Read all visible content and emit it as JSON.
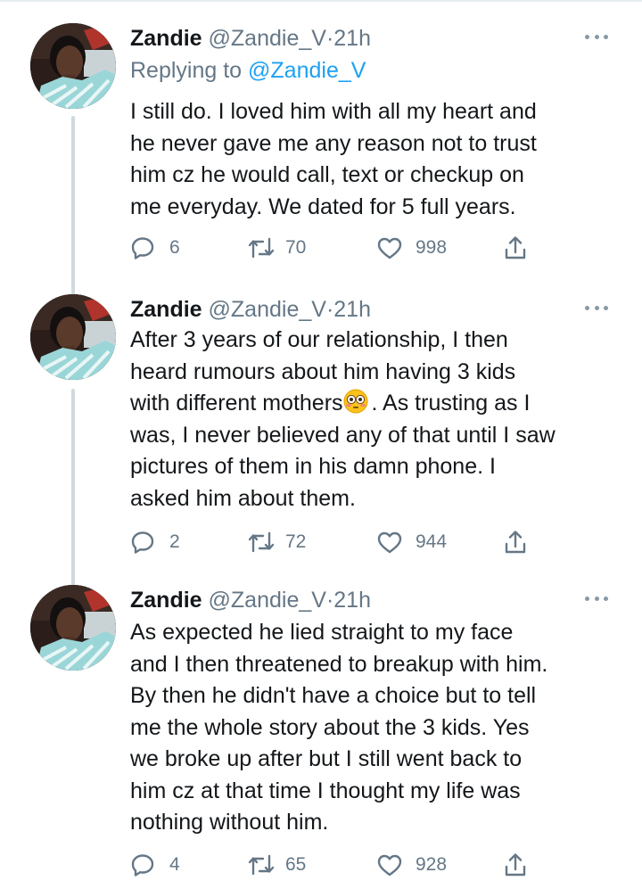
{
  "tweets": [
    {
      "name": "Zandie",
      "handle": "@Zandie_V",
      "separator": "·",
      "time": "21h",
      "replying_prefix": "Replying to ",
      "replying_to": "@Zandie_V",
      "lines": [
        "I still do. I loved him with all my heart and",
        "he never gave me any reason not to trust",
        "him cz he would call, text or checkup on",
        "me everyday. We dated for 5 full years."
      ],
      "replies": "6",
      "retweets": "70",
      "likes": "998"
    },
    {
      "name": "Zandie",
      "handle": "@Zandie_V",
      "separator": "·",
      "time": "21h",
      "lines": [
        "After 3 years of our relationship, I then",
        "heard rumours about him having 3 kids",
        "with different mothers",
        "was, I never believed any of that until I saw",
        "pictures of them in his damn phone. I",
        "asked him about them."
      ],
      "line3_after_emoji": ". As trusting as I",
      "emoji": "flushed-face",
      "replies": "2",
      "retweets": "72",
      "likes": "944"
    },
    {
      "name": "Zandie",
      "handle": "@Zandie_V",
      "separator": "·",
      "time": "21h",
      "lines": [
        "As expected he lied straight to my face",
        "and I then threatened to breakup with him.",
        "By then he didn't have a choice but to tell",
        "me the whole story about the 3 kids. Yes",
        "we broke up after but I still went back to",
        "him cz at that time I thought my life was",
        "nothing without him."
      ],
      "replies": "4",
      "retweets": "65",
      "likes": "928"
    }
  ],
  "icons": {
    "reply": "reply-icon",
    "retweet": "retweet-icon",
    "like": "heart-icon",
    "share": "share-icon",
    "more": "more-options-icon"
  },
  "colors": {
    "text": "#14171a",
    "secondary": "#657786",
    "mention": "#1da1f2",
    "thread_line": "#cfd9de"
  }
}
